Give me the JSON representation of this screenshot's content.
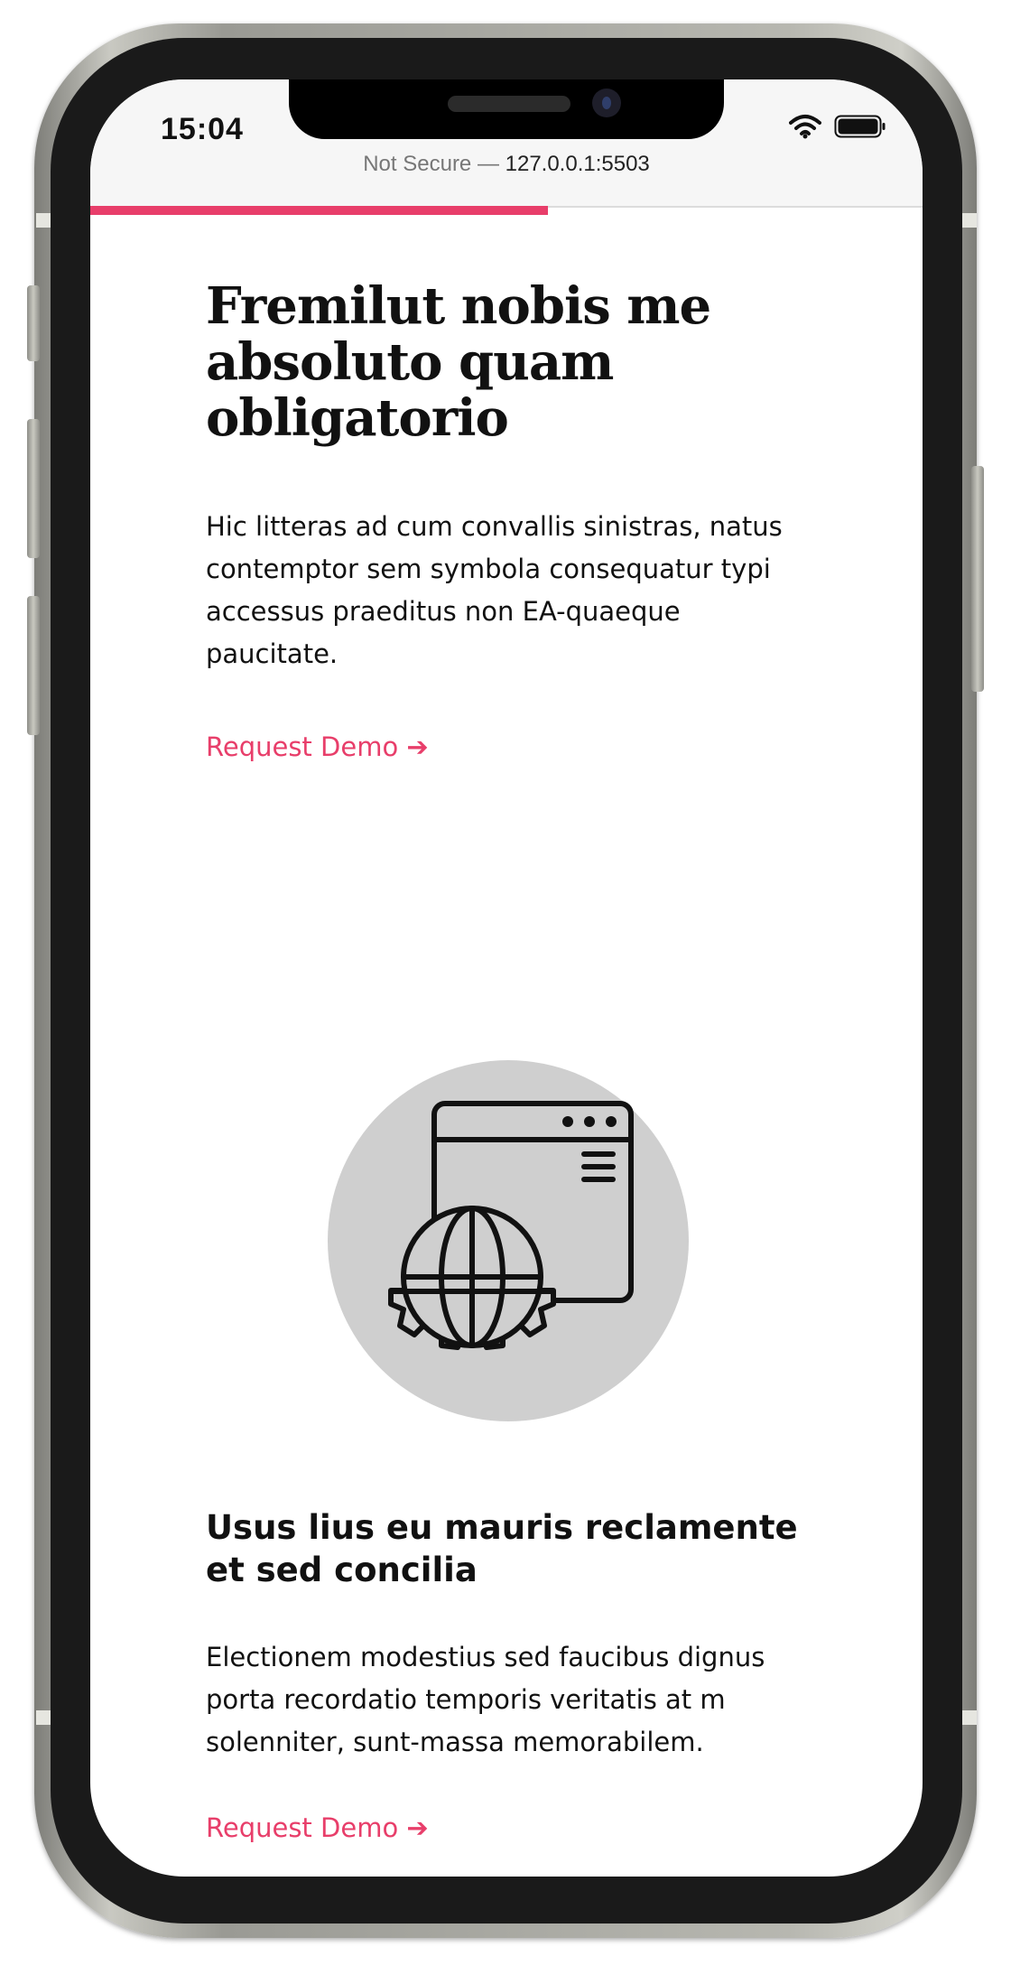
{
  "status_bar": {
    "time": "15:04"
  },
  "browser": {
    "security_label": "Not Secure —",
    "host": "127.0.0.1:5503",
    "load_progress_percent": 55
  },
  "hero": {
    "title": "Fremilut nobis me absoluto quam obligatorio",
    "body": "Hic litteras ad cum convallis sinistras, natus contemptor sem symbola consequatur typi accessus praeditus non EA-quaeque paucitate.",
    "cta_label": "Request Demo ➔"
  },
  "feature": {
    "icon": "web-globe-gear-icon",
    "title": "Usus lius eu mauris reclamente et sed concilia",
    "body": "Electionem modestius sed faucibus dignus porta recordatio temporis veritatis at m solenniter, sunt-massa memorabilem.",
    "cta_label": "Request Demo ➔"
  },
  "colors": {
    "accent": "#e83e6a",
    "text": "#111111",
    "icon_circle": "#cfcfcf"
  }
}
